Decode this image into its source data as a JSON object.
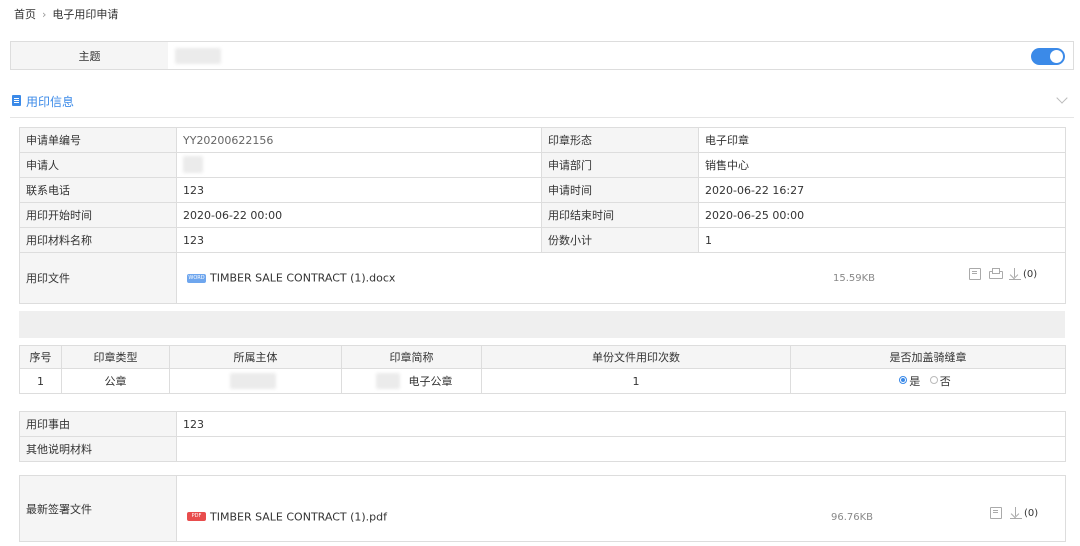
{
  "breadcrumb": {
    "home": "首页",
    "current": "电子用印申请"
  },
  "subject": {
    "label": "主题",
    "toggle_on": true
  },
  "section": {
    "title": "用印信息"
  },
  "info": {
    "application_no": {
      "label": "申请单编号",
      "value": "YY20200622156"
    },
    "seal_form": {
      "label": "印章形态",
      "value": "电子印章"
    },
    "applicant": {
      "label": "申请人"
    },
    "department": {
      "label": "申请部门",
      "value": "销售中心"
    },
    "phone": {
      "label": "联系电话",
      "value": "123"
    },
    "apply_time": {
      "label": "申请时间",
      "value": "2020-06-22 16:27"
    },
    "start_time": {
      "label": "用印开始时间",
      "value": "2020-06-22 00:00"
    },
    "end_time": {
      "label": "用印结束时间",
      "value": "2020-06-25 00:00"
    },
    "material_name": {
      "label": "用印材料名称",
      "value": "123"
    },
    "copies": {
      "label": "份数小计",
      "value": "1"
    },
    "file": {
      "label": "用印文件",
      "badge": "WORD",
      "name": "TIMBER SALE CONTRACT (1).docx",
      "size": "15.59KB",
      "count": "(0)"
    }
  },
  "seal_table": {
    "headers": [
      "序号",
      "印章类型",
      "所属主体",
      "印章简称",
      "单份文件用印次数",
      "是否加盖骑缝章"
    ],
    "rows": [
      {
        "index": "1",
        "type": "公章",
        "short_name": "电子公章",
        "times": "1",
        "yes": "是",
        "no": "否",
        "selected": "yes"
      }
    ]
  },
  "reason": {
    "reason_label": "用印事由",
    "reason_value": "123",
    "other_label": "其他说明材料",
    "other_value": ""
  },
  "signed": {
    "label": "最新签署文件",
    "badge": "PDF",
    "name": "TIMBER SALE CONTRACT (1).pdf",
    "size": "96.76KB",
    "count": "(0)"
  }
}
